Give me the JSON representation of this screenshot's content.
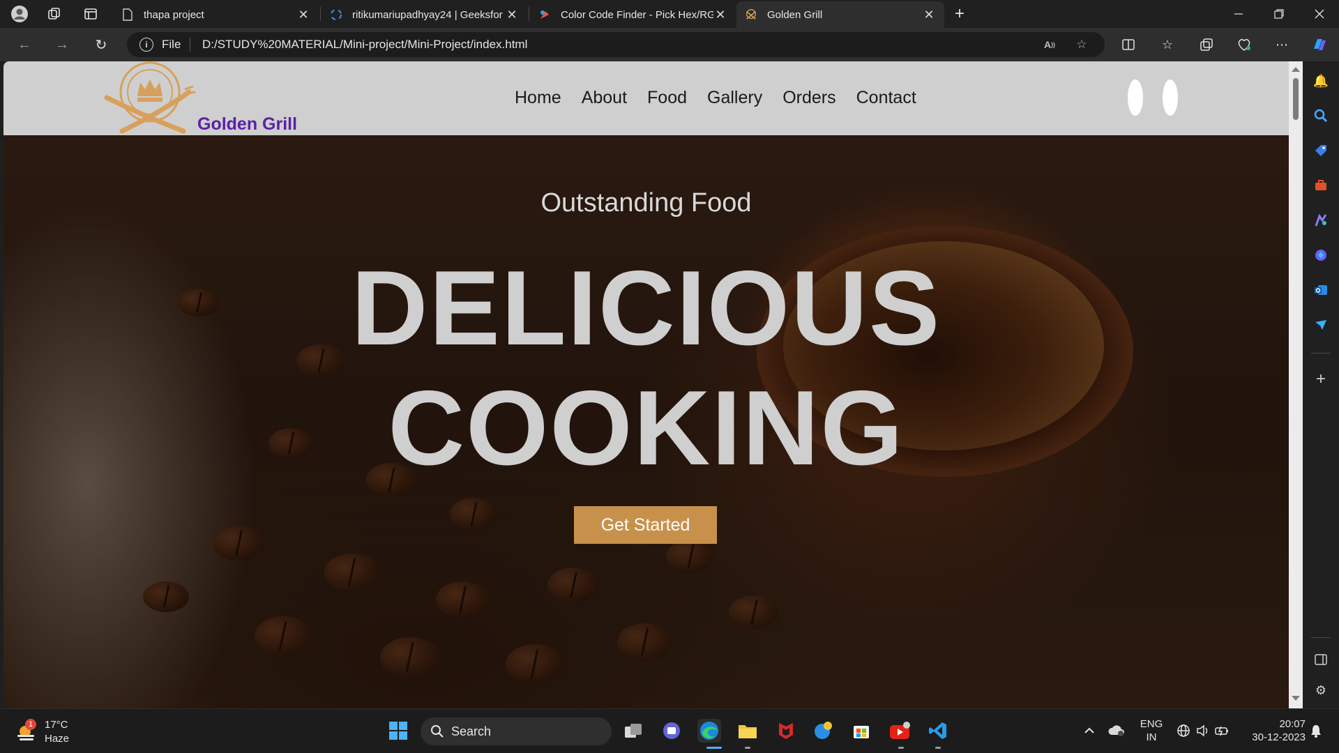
{
  "browser": {
    "tabs": [
      {
        "title": "thapa project",
        "active": false
      },
      {
        "title": "ritikumariupadhyay24 | Geeksfor",
        "active": false
      },
      {
        "title": "Color Code Finder - Pick Hex/RG",
        "active": false
      },
      {
        "title": "Golden Grill",
        "active": true
      }
    ],
    "address": {
      "scheme_label": "File",
      "url": "D:/STUDY%20MATERIAL/Mini-project/Mini-Project/index.html"
    }
  },
  "site": {
    "brand": "Golden Grill",
    "nav": [
      "Home",
      "About",
      "Food",
      "Gallery",
      "Orders",
      "Contact"
    ],
    "hero": {
      "subtitle": "Outstanding Food",
      "title_line1": "DELICIOUS",
      "title_line2": "COOKING",
      "cta": "Get Started"
    },
    "colors": {
      "header_bg": "#cfcfcf",
      "brand_text": "#5b21a6",
      "cta_bg": "#c8914b",
      "logo_gold": "#d7a05c"
    }
  },
  "taskbar": {
    "weather": {
      "temp": "17°C",
      "condition": "Haze",
      "badge": "1"
    },
    "search_label": "Search",
    "language": {
      "line1": "ENG",
      "line2": "IN"
    },
    "clock": {
      "time": "20:07",
      "date": "30-12-2023"
    }
  }
}
